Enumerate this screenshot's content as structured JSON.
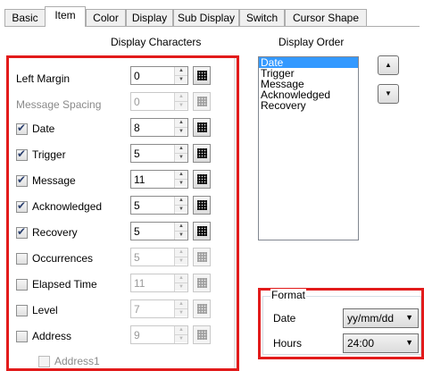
{
  "tabs": [
    "Basic",
    "Item",
    "Color",
    "Display",
    "Sub Display",
    "Switch",
    "Cursor Shape"
  ],
  "headers": {
    "display_characters": "Display Characters",
    "display_order": "Display Order"
  },
  "rows": [
    {
      "label": "Left Margin",
      "value": "0",
      "checkbox": false,
      "checked": false,
      "enabled": true
    },
    {
      "label": "Message Spacing",
      "value": "0",
      "checkbox": false,
      "checked": false,
      "enabled": false
    },
    {
      "label": "Date",
      "value": "8",
      "checkbox": true,
      "checked": true,
      "enabled": true
    },
    {
      "label": "Trigger",
      "value": "5",
      "checkbox": true,
      "checked": true,
      "enabled": true
    },
    {
      "label": "Message",
      "value": "11",
      "checkbox": true,
      "checked": true,
      "enabled": true
    },
    {
      "label": "Acknowledged",
      "value": "5",
      "checkbox": true,
      "checked": true,
      "enabled": true
    },
    {
      "label": "Recovery",
      "value": "5",
      "checkbox": true,
      "checked": true,
      "enabled": true
    },
    {
      "label": "Occurrences",
      "value": "5",
      "checkbox": true,
      "checked": false,
      "enabled": false
    },
    {
      "label": "Elapsed Time",
      "value": "11",
      "checkbox": true,
      "checked": false,
      "enabled": false
    },
    {
      "label": "Level",
      "value": "7",
      "checkbox": true,
      "checked": false,
      "enabled": false
    },
    {
      "label": "Address",
      "value": "9",
      "checkbox": true,
      "checked": false,
      "enabled": false
    }
  ],
  "sub_row": {
    "label": "Address1"
  },
  "display_order": {
    "items": [
      "Date",
      "Trigger",
      "Message",
      "Acknowledged",
      "Recovery"
    ],
    "selected": "Date"
  },
  "move_buttons": {
    "up": "▲",
    "down": "▼"
  },
  "format": {
    "legend": "Format",
    "date_label": "Date",
    "date_value": "yy/mm/dd",
    "hours_label": "Hours",
    "hours_value": "24:00"
  },
  "colors": {
    "highlight": "#e21b1b",
    "selection": "#3399ff"
  }
}
